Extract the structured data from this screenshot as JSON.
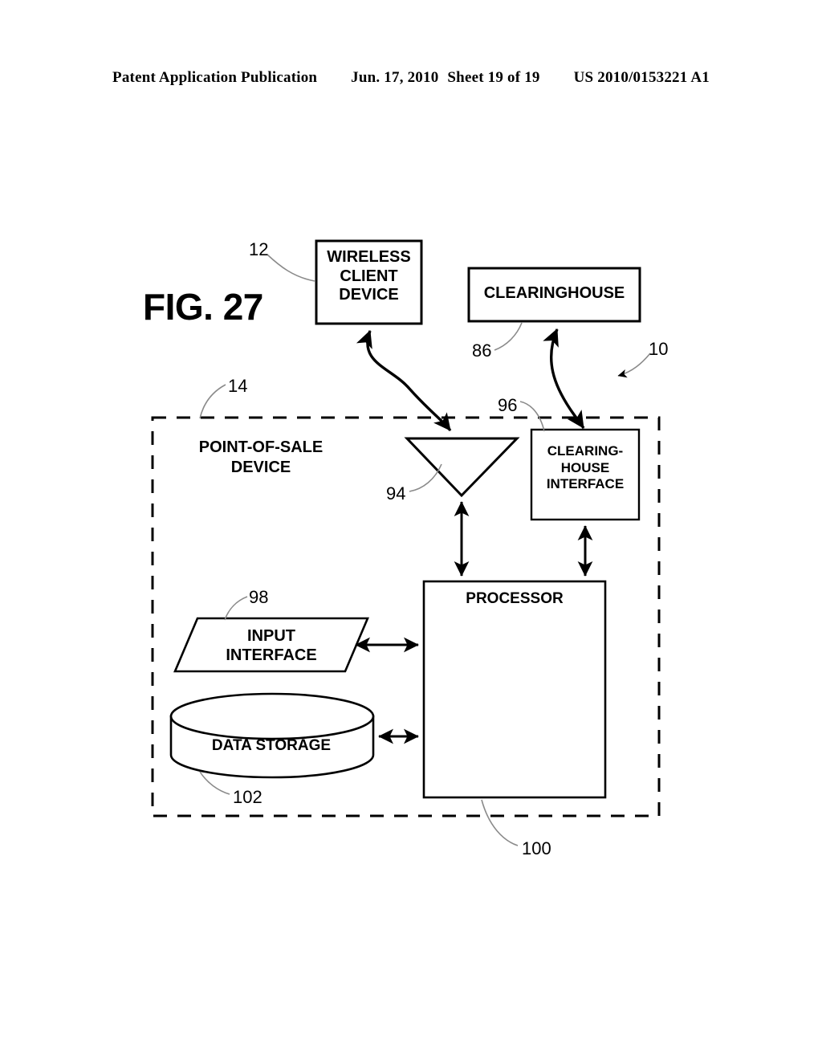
{
  "header": {
    "publication": "Patent Application Publication",
    "date": "Jun. 17, 2010",
    "sheet": "Sheet 19 of 19",
    "doc_number": "US 2010/0153221 A1"
  },
  "figure": {
    "caption": "FIG. 27",
    "blocks": {
      "wireless_client_device": "WIRELESS\nCLIENT\nDEVICE",
      "clearinghouse": "CLEARINGHOUSE",
      "pos_device": "POINT-OF-SALE\nDEVICE",
      "clearinghouse_interface": "CLEARING-\nHOUSE\nINTERFACE",
      "processor": "PROCESSOR",
      "input_interface": "INPUT\nINTERFACE",
      "data_storage": "DATA STORAGE"
    },
    "reference_numerals": {
      "system": "10",
      "wireless_client_device": "12",
      "pos_device": "14",
      "clearinghouse": "86",
      "transceiver": "94",
      "clearinghouse_interface": "96",
      "input_interface": "98",
      "processor": "100",
      "data_storage": "102"
    },
    "colors": {
      "ink": "#000000",
      "paper": "#ffffff"
    }
  }
}
